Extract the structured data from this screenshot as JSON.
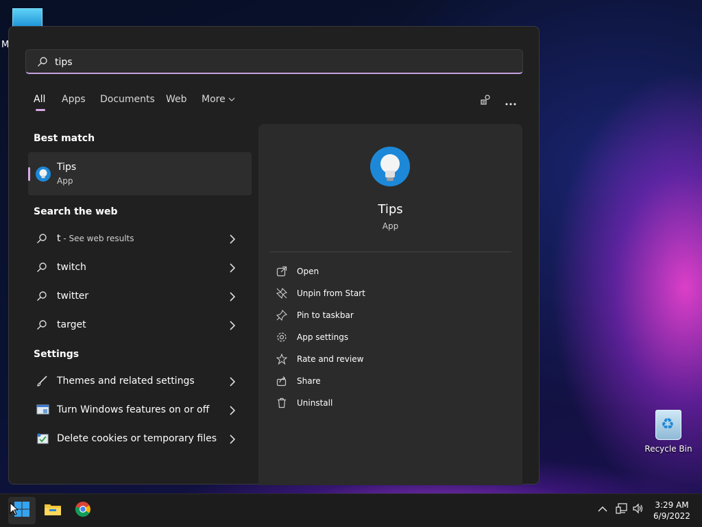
{
  "desktop": {
    "corner_letter": "M",
    "recycle_bin_label": "Recycle Bin"
  },
  "search": {
    "value": "tips",
    "icon": "search-icon"
  },
  "tabs": [
    {
      "label": "All",
      "active": true
    },
    {
      "label": "Apps"
    },
    {
      "label": "Documents"
    },
    {
      "label": "Web"
    },
    {
      "label": "More"
    }
  ],
  "best_match": {
    "title": "Best match",
    "name": "Tips",
    "type": "App"
  },
  "web": {
    "title": "Search the web",
    "items": [
      {
        "text": "t",
        "suffix": " - See web results"
      },
      {
        "text": "twitch"
      },
      {
        "text": "twitter"
      },
      {
        "text": "target"
      }
    ]
  },
  "settings": {
    "title": "Settings",
    "items": [
      {
        "text": "Themes and related settings",
        "icon": "brush-icon"
      },
      {
        "text": "Turn Windows features on or off",
        "icon": "windows-features-icon"
      },
      {
        "text": "Delete cookies or temporary files",
        "icon": "disk-cleanup-icon"
      }
    ]
  },
  "detail": {
    "name": "Tips",
    "type": "App",
    "actions": [
      {
        "label": "Open",
        "icon": "open-icon"
      },
      {
        "label": "Unpin from Start",
        "icon": "unpin-icon"
      },
      {
        "label": "Pin to taskbar",
        "icon": "pin-icon"
      },
      {
        "label": "App settings",
        "icon": "gear-icon"
      },
      {
        "label": "Rate and review",
        "icon": "star-icon"
      },
      {
        "label": "Share",
        "icon": "share-icon"
      },
      {
        "label": "Uninstall",
        "icon": "trash-icon"
      }
    ]
  },
  "taskbar": {
    "time": "3:29 AM",
    "date": "6/9/2022"
  },
  "colors": {
    "accent": "#d9a8e6",
    "panel": "#202020",
    "detail": "#2b2b2b"
  }
}
